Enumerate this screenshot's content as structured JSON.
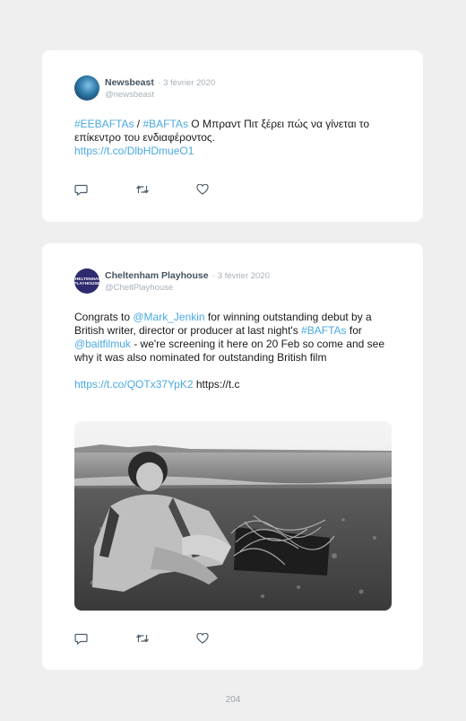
{
  "tweets": [
    {
      "name": "Newsbeast",
      "date": "· 3 février 2020",
      "handle": "@newsbeast",
      "text": {
        "tag1": "#EEBAFTAs",
        "sep": " / ",
        "tag2": "#BAFTAs",
        "body": " Ο Μπραντ Πιτ ξέρει πώς να γίνεται το επίκεντρο του ενδιαφέροντος.",
        "url": "https://t.co/DlbHDmueO1"
      },
      "actions": [
        "reply-icon",
        "retweet-icon",
        "like-icon"
      ]
    },
    {
      "name": "Cheltenham Playhouse",
      "date": "· 3 février 2020",
      "handle": "@CheltPlayhouse",
      "avatar_text": "CHELTENHAM PLAYHOUSE",
      "text": {
        "p1": "Congrats to ",
        "mention1": "@Mark_Jenkin",
        "p2": " for winning outstanding debut by a British writer, director or producer at last night's ",
        "tag": "#BAFTAs",
        "p3": " for ",
        "mention2": "@baitfilmuk",
        "p4": " - we're screening it here on 20 Feb so come and see why it was also nominated for outstanding British film",
        "url": "https://t.co/QOTx37YpK2",
        "url_tail": " https://t.c"
      },
      "actions": [
        "reply-icon",
        "retweet-icon",
        "like-icon"
      ]
    }
  ],
  "page_number": "204"
}
